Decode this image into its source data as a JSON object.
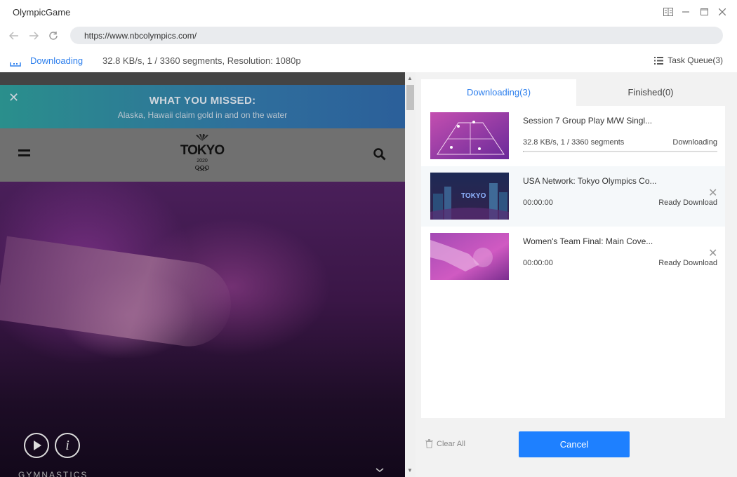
{
  "window": {
    "title": "OlympicGame"
  },
  "nav": {
    "url": "https://www.nbcolympics.com/"
  },
  "status": {
    "label": "Downloading",
    "info": "32.8 KB/s, 1 / 3360 segments, Resolution: 1080p",
    "task_queue": "Task Queue(3)"
  },
  "webpage": {
    "banner_title": "WHAT YOU MISSED:",
    "banner_subtitle": "Alaska, Hawaii claim gold in and on the water",
    "logo_word": "TOKYO",
    "logo_year": "2020",
    "sport_label": "GYMNASTICS"
  },
  "panel": {
    "tabs": [
      {
        "label": "Downloading(3)",
        "active": true
      },
      {
        "label": "Finished(0)",
        "active": false
      }
    ],
    "items": [
      {
        "title": "Session 7 Group Play M/W Singl...",
        "meta": "32.8 KB/s, 1 / 3360 segments",
        "status": "Downloading",
        "progress": 0.0003
      },
      {
        "title": "USA Network: Tokyo Olympics Co...",
        "meta": "00:00:00",
        "status": "Ready Download"
      },
      {
        "title": "Women's Team Final: Main Cove...",
        "meta": "00:00:00",
        "status": "Ready Download"
      }
    ],
    "clear_all": "Clear All",
    "cancel": "Cancel"
  },
  "colors": {
    "accent": "#2f80ed",
    "button": "#1e80ff"
  }
}
